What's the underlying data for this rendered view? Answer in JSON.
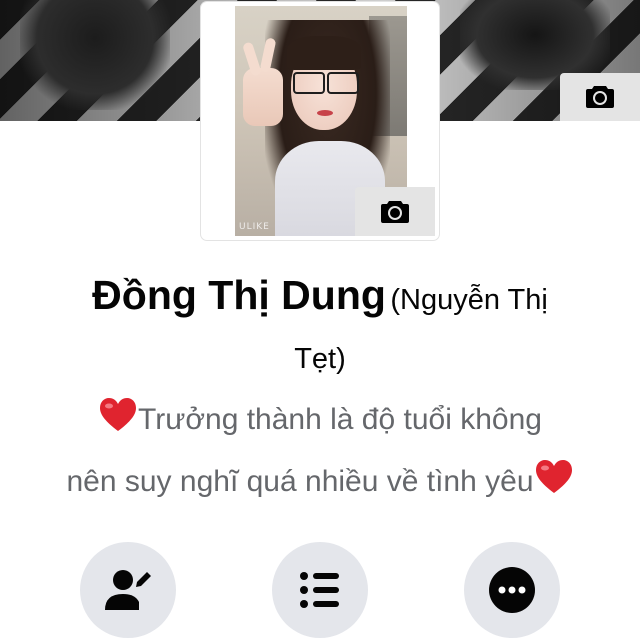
{
  "profile": {
    "name": "Đồng Thị Dung",
    "alternate_name_line1": "(Nguyễn Thị",
    "alternate_name_line2": "Tẹt)",
    "bio_line1": "Trưởng thành là độ tuổi không",
    "bio_line2": "nên suy nghĩ quá nhiều về tình yêu",
    "avatar_watermark": "ULIKE"
  },
  "icons": {
    "cover_camera": "camera-icon",
    "avatar_camera": "camera-icon",
    "heart": "heart-emoji-icon",
    "edit_profile": "person-edit-icon",
    "activity_log": "list-icon",
    "more": "more-dots-icon"
  },
  "colors": {
    "name": "#050505",
    "bio": "#65676b",
    "button_bg": "#e4e6eb",
    "camera_button_bg": "#e4e4e4",
    "heart": "#e0242f"
  }
}
